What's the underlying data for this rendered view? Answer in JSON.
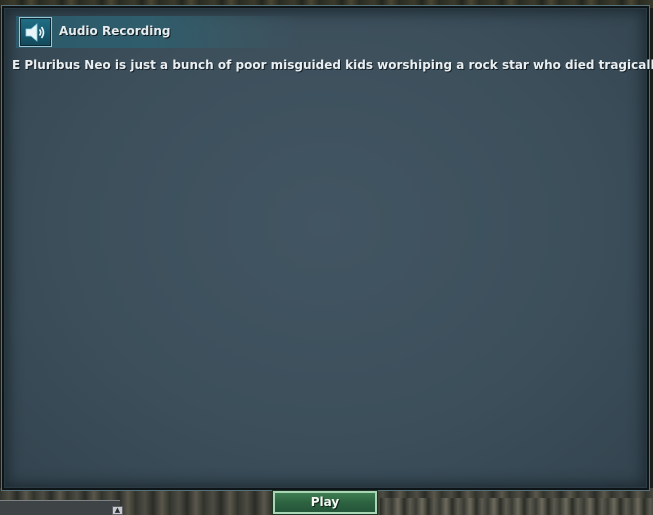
{
  "dialog": {
    "title": "Audio Recording",
    "icon": "speaker-icon",
    "message": "E Pluribus Neo is just a bunch of poor misguided kids worshiping a rock star who died tragically."
  },
  "actions": {
    "play_label": "Play"
  },
  "colors": {
    "panel_background": "#3c4f5b",
    "title_accent": "#2c5a6a",
    "play_button": "#2d6340",
    "text": "#e9eef0"
  }
}
